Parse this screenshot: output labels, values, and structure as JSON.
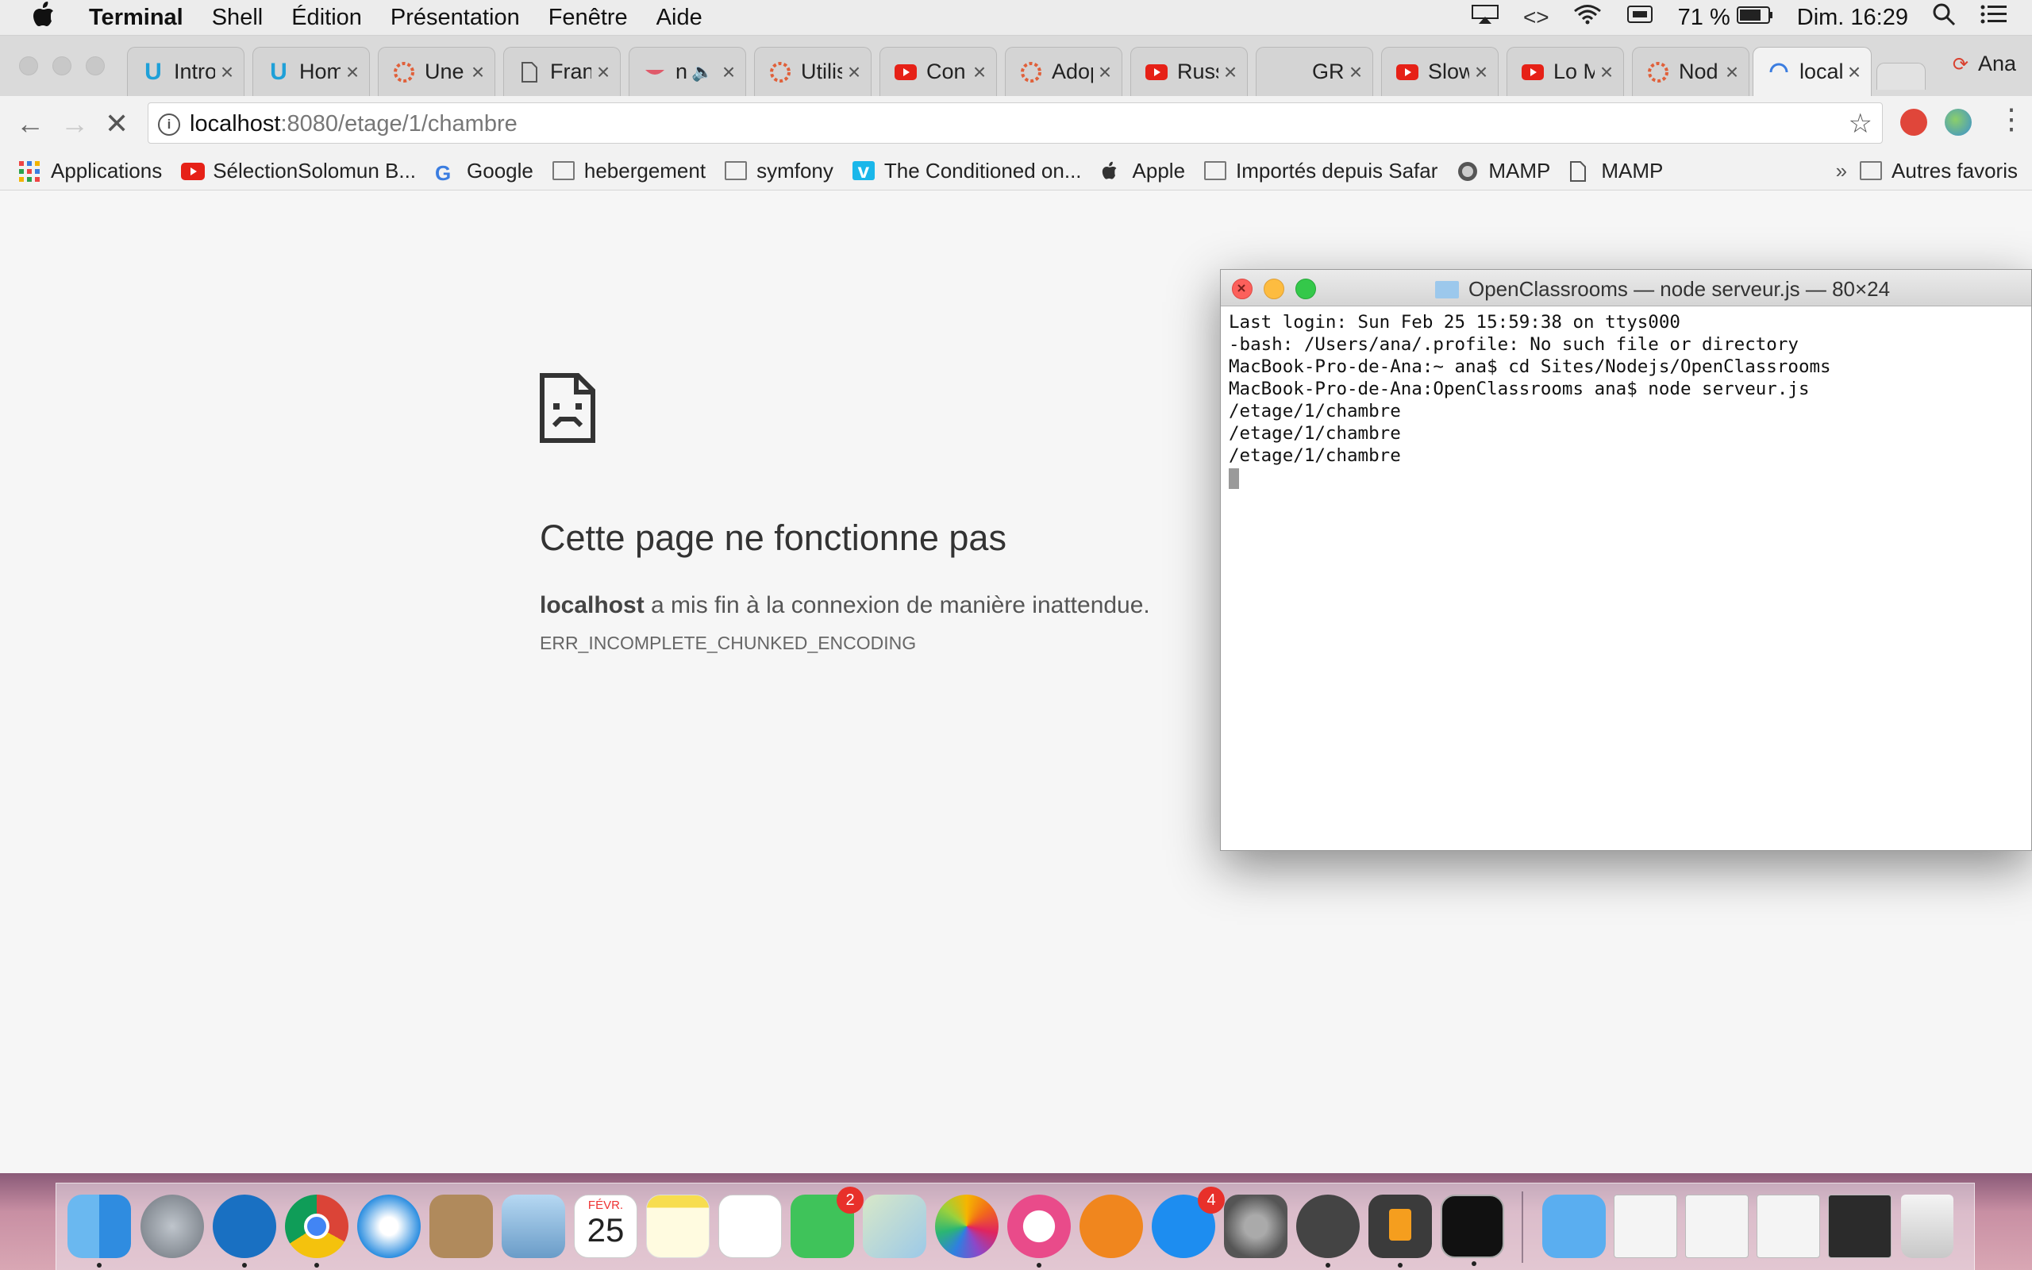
{
  "menubar": {
    "app": "Terminal",
    "items": [
      "Shell",
      "Édition",
      "Présentation",
      "Fenêtre",
      "Aide"
    ],
    "battery": "71 %",
    "clock": "Dim. 16:29"
  },
  "tabs": [
    {
      "label": "Intro",
      "icon": "udacity-icon"
    },
    {
      "label": "Hom",
      "icon": "udacity-icon"
    },
    {
      "label": "Une",
      "icon": "openclassrooms-icon"
    },
    {
      "label": "Fran",
      "icon": "page-icon"
    },
    {
      "label": "ni",
      "icon": "audio-icon"
    },
    {
      "label": "Utilis",
      "icon": "openclassrooms-icon"
    },
    {
      "label": "Con",
      "icon": "youtube-icon"
    },
    {
      "label": "Adop",
      "icon": "openclassrooms-icon"
    },
    {
      "label": "Russ",
      "icon": "youtube-icon"
    },
    {
      "label": "GRO",
      "icon": "none"
    },
    {
      "label": "Slow",
      "icon": "youtube-icon"
    },
    {
      "label": "Lo M",
      "icon": "youtube-icon"
    },
    {
      "label": "Nod",
      "icon": "openclassrooms-icon"
    },
    {
      "label": "local",
      "icon": "loading-icon"
    }
  ],
  "profile": "Ana",
  "address": {
    "host": "localhost",
    "path": ":8080/etage/1/chambre"
  },
  "bookmarks": [
    {
      "label": "Applications",
      "icon": "apps-grid-icon"
    },
    {
      "label": "SélectionSolomun B...",
      "icon": "youtube-icon"
    },
    {
      "label": "Google",
      "icon": "google-icon"
    },
    {
      "label": "hebergement",
      "icon": "folder-icon"
    },
    {
      "label": "symfony",
      "icon": "folder-icon"
    },
    {
      "label": "The Conditioned on...",
      "icon": "vimeo-icon"
    },
    {
      "label": "Apple",
      "icon": "apple-icon"
    },
    {
      "label": "Importés depuis Safar",
      "icon": "folder-icon"
    },
    {
      "label": "MAMP",
      "icon": "mamp-icon"
    },
    {
      "label": "MAMP",
      "icon": "page-icon"
    }
  ],
  "bookmarks_more": "»",
  "bookmarks_other": "Autres favoris",
  "error": {
    "title": "Cette page ne fonctionne pas",
    "host": "localhost",
    "message": " a mis fin à la connexion de manière inattendue.",
    "code": "ERR_INCOMPLETE_CHUNKED_ENCODING"
  },
  "terminal": {
    "title": "OpenClassrooms — node serveur.js — 80×24",
    "lines": [
      "Last login: Sun Feb 25 15:59:38 on ttys000",
      "-bash: /Users/ana/.profile: No such file or directory",
      "MacBook-Pro-de-Ana:~ ana$ cd Sites/Nodejs/OpenClassrooms",
      "MacBook-Pro-de-Ana:OpenClassrooms ana$ node serveur.js",
      "/etage/1/chambre",
      "/etage/1/chambre",
      "/etage/1/chambre"
    ]
  },
  "dock": {
    "calendar_month": "FÉVR.",
    "calendar_day": "25",
    "facetime_badge": "2",
    "appstore_badge": "4"
  }
}
